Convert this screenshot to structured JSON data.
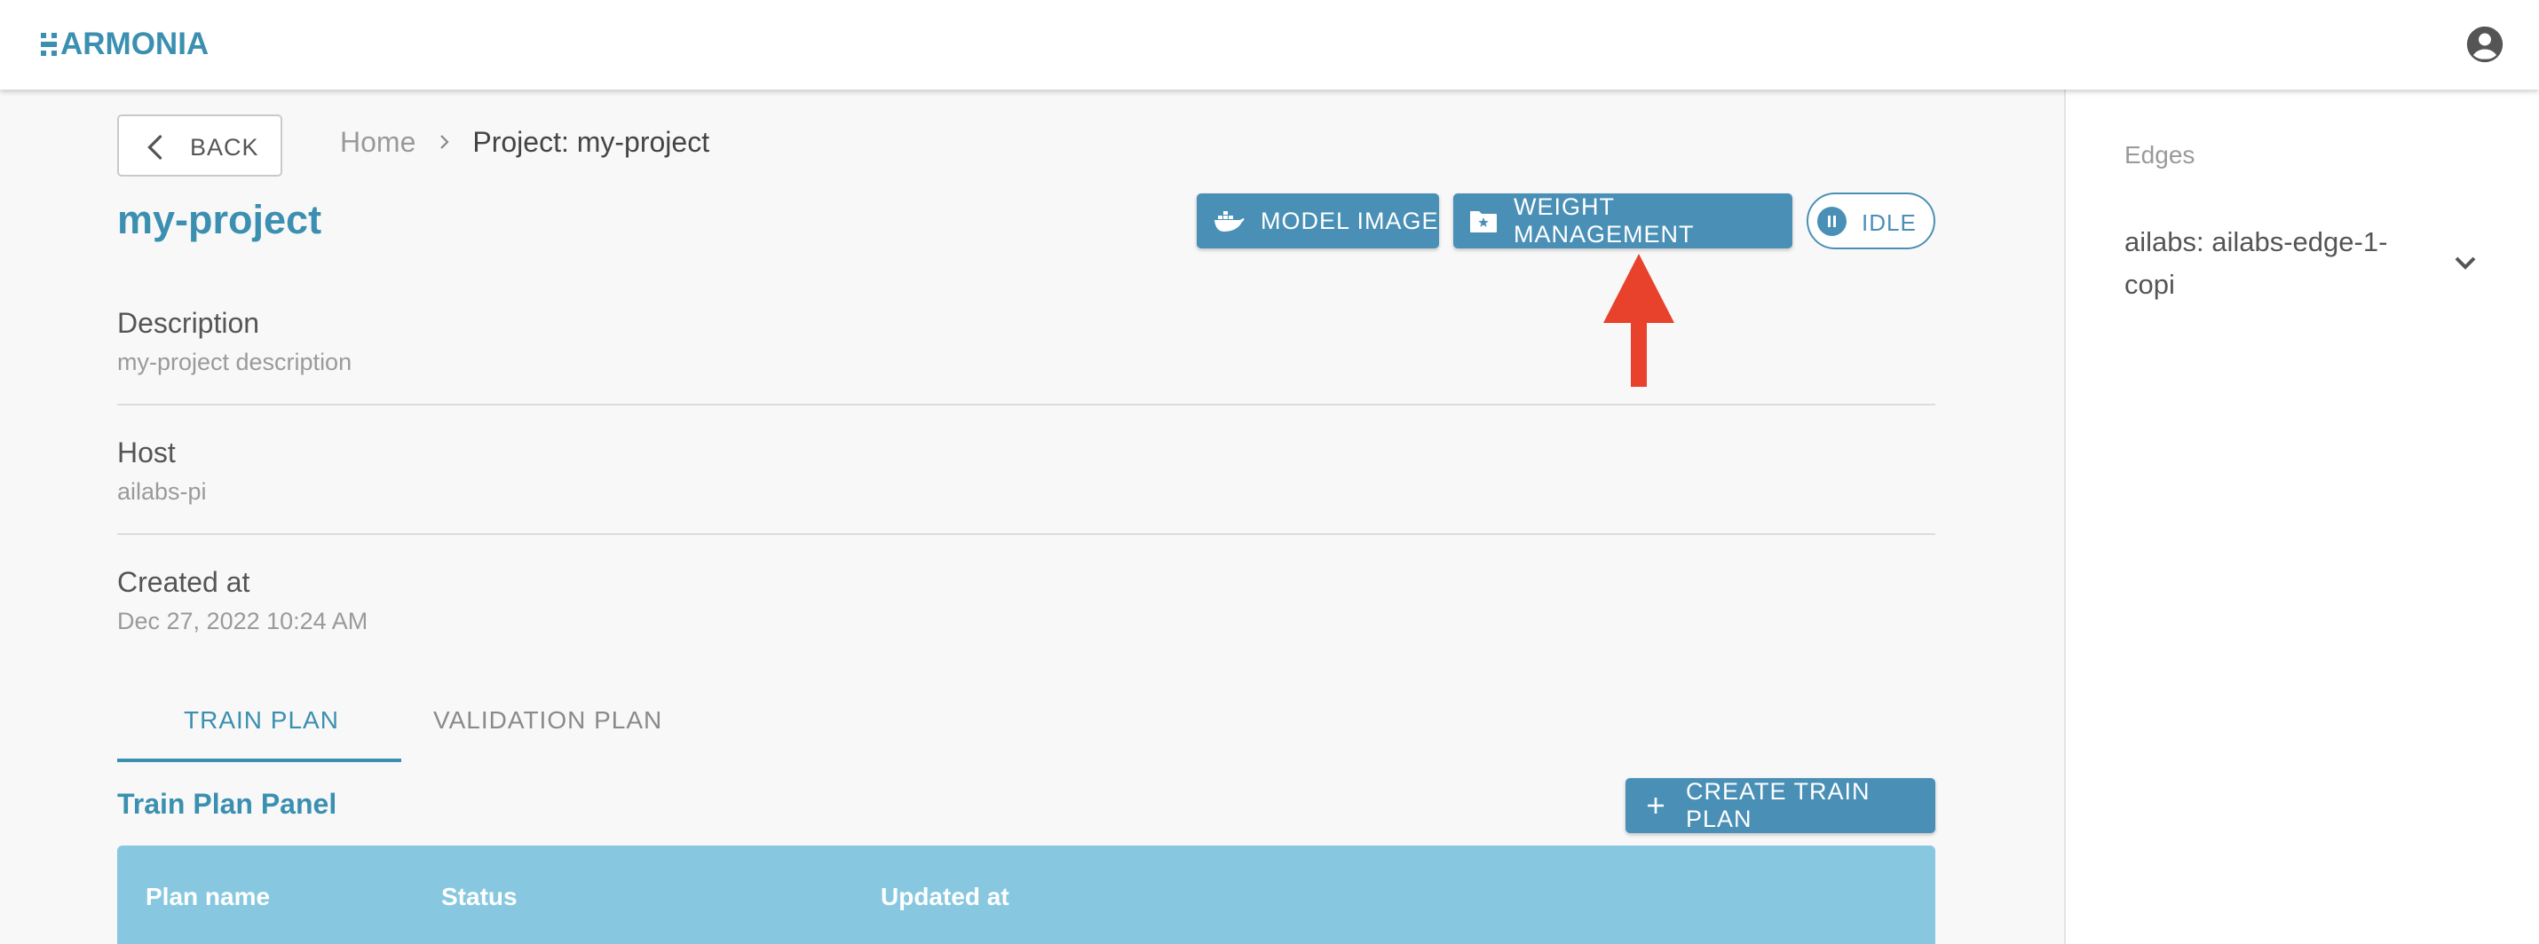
{
  "app": {
    "name": "ARMONIA"
  },
  "header": {
    "account_icon": "account-circle-icon"
  },
  "nav": {
    "back_label": "BACK"
  },
  "breadcrumb": {
    "home": "Home",
    "current": "Project: my-project"
  },
  "project": {
    "title": "my-project",
    "fields": [
      {
        "label": "Description",
        "value": "my-project description"
      },
      {
        "label": "Host",
        "value": "ailabs-pi"
      },
      {
        "label": "Created at",
        "value": "Dec 27, 2022 10:24 AM"
      }
    ]
  },
  "actions": {
    "model_image": "MODEL IMAGE",
    "weight_management": "WEIGHT MANAGEMENT",
    "status": "IDLE"
  },
  "tabs": [
    {
      "label": "TRAIN PLAN",
      "active": true
    },
    {
      "label": "VALIDATION PLAN",
      "active": false
    }
  ],
  "panel": {
    "title": "Train Plan Panel",
    "create_label": "CREATE TRAIN PLAN",
    "columns": [
      "Plan name",
      "Status",
      "Updated at"
    ]
  },
  "sidebar": {
    "title": "Edges",
    "edge": "ailabs: ailabs-edge-1-copi"
  },
  "colors": {
    "accent": "#4a90b6",
    "brand": "#3b8fb0",
    "table_header": "#87c8e0",
    "annotation_arrow": "#e8412c"
  }
}
